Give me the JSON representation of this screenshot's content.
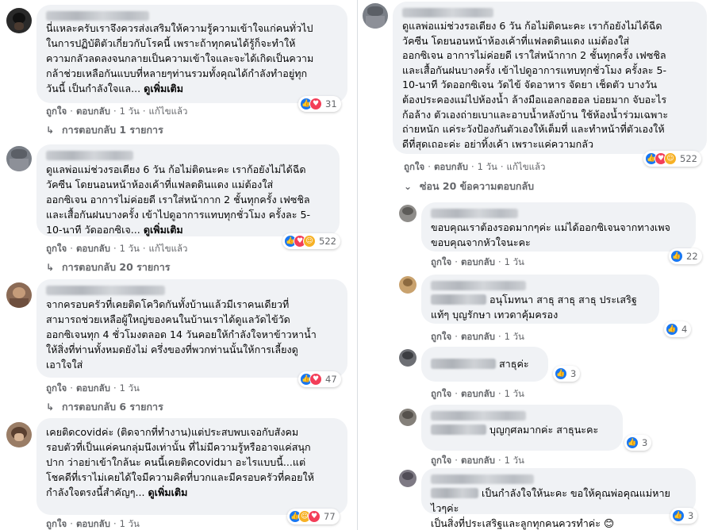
{
  "common": {
    "like": "ถูกใจ",
    "reply": "ตอบกลับ",
    "edited": "แก้ไขแล้ว",
    "see_more": "ดูเพิ่มเติม",
    "age_1_day": "1 วัน"
  },
  "left_comments": [
    {
      "text": "นี่แหละครับเราจึงควรส่งเสริมให้ความรู้ความเข้าใจแก่คนทั่วไป\nในการปฏิบัติตัวเกี่ยวกับโรคนี้ เพราะถ้าทุกคนได้รู้ก็จะทำให้\nความกลัวลดลงจนกลายเป็นความเข้าใจและจะได้เกิดเป็นความ\nกล้าช่วยเหลือกันแบบที่หลายๆท่านรวมทั้งคุณได้กำลังทำอยู่ทุก\nวันนี้ เป็นกำลังใจแล...",
      "reactions": [
        "like",
        "love"
      ],
      "count": "31",
      "replies": "การตอบกลับ 1 รายการ"
    },
    {
      "text": "ดูแลพ่อแม่ช่วงรอเตียง 6 วัน ก้อไม่ติดนะคะ เราก้อยังไม่ได้ฉีด\nวัคซีน โดยนอนหน้าห้องเค้าที่แฟลตดินแดง แม่ต้องใส่\nออกซิเจน อาการไม่ค่อยดี เราใส่หน้ากาก 2 ชั้นทุกครั้ง เฟซชิล\nและเสื้อกันฝนบางครั้ง เข้าไปดูอาการแทบทุกชั่วโมง ครั้งละ 5-\n10-นาที วัดออกซิเจ...",
      "reactions": [
        "like",
        "love",
        "care"
      ],
      "count": "522",
      "replies": "การตอบกลับ 20 รายการ"
    },
    {
      "text": "จากครอบครัวที่เคยติดโควิดกันทั้งบ้านแล้วมีเราคนเดียวที่\nสามารถช่วยเหลือผู้ใหญ่ของคนในบ้านเราได้ดูแลวัดไข้วัด\nออกซิเจนทุก 4 ชั่วโมงตลอด 14 วันคอยให้กำลังใจหาข้าวหาน้ำ\nให้สิ่งที่ท่านทั้งหมดยังไม่ ครึ่งของที่พวกท่านนั้นให้การเลี้ยงดู\nเอาใจใส่",
      "reactions": [
        "like",
        "love"
      ],
      "count": "47",
      "replies": "การตอบกลับ 6 รายการ"
    },
    {
      "text": "เคยติดcovidค่ะ (ติดจากที่ทำงาน)แต่ประสบพบเจอกับสังคม\nรอบตัวที่เป็นแค่คนกลุ่มนึงเท่านั้น ที่ไม่มีความรู้หรืออาจแค่สนุก\nปาก ว่าอย่าเข้าใกล้นะ คนนี้เคยติดcovidมา อะไรแบบนี้...แต่\nโชคดีที่เราไม่เคยได้ใจมีความคิดที่บวกและมีครอบครัวที่คอยให้\nกำลังใจตรงนี้สำคัญๆ...",
      "reactions": [
        "like",
        "care",
        "love"
      ],
      "count": "77"
    }
  ],
  "right_main": {
    "text": "ดูแลพ่อแม่ช่วงรอเตียง 6 วัน ก้อไม่ติดนะคะ เราก้อยังไม่ได้ฉีด\nวัคซีน โดยนอนหน้าห้องเค้าที่แฟลตดินแดง แม่ต้องใส่\nออกซิเจน อาการไม่ค่อยดี เราใส่หน้ากาก 2 ชั้นทุกครั้ง เฟซชิล\nและเสื้อกันฝนบางครั้ง เข้าไปดูอาการแทบทุกชั่วโมง ครั้งละ 5-\n10-นาที วัดออกซิเจน วัดไข้ จัดอาหาร จัดยา เช็ดตัว บางวัน\nต้องประคองแม่ไปห้องน้ำ ล้างมือแอลกอฮอล บ่อยมาก จับอะไร\nก้อล้าง ตัวเองถ่ายเบาและอาบน้ำหลังบ้าน ใช้ห้องน้ำร่วมเฉพาะ\nถ่ายหนัก แค่ระวังป้องกันตัวเองให้เต็มที่ และทำหน้าที่ตัวเองให้\nดีที่สุดเถอะค่ะ อย่าทิ้งเค้า เพราะแค่ความกลัว",
    "reactions": [
      "like",
      "love",
      "care"
    ],
    "count": "522",
    "hide_replies": "ซ่อน 20 ข้อความตอบกลับ"
  },
  "right_replies": [
    {
      "text": "ขอบคุณเราต้องรอดมากๆค่ะ แม่ได้ออกซิเจนจากทางเพจ\nขอบคุณจากหัวใจนะคะ",
      "reactions": [
        "like"
      ],
      "count": "22"
    },
    {
      "text": "อนุโมทนา สาธุ สาธุ สาธุ ประเสริฐ\nแท้ๆ บุญรักษา เทวดาคุ้มครอง",
      "reactions": [
        "like"
      ],
      "count": "4"
    },
    {
      "text": "สาธุค่ะ",
      "reactions": [
        "like"
      ],
      "count": "3"
    },
    {
      "text": "บุญกุศลมากค่ะ สาธุนะคะ",
      "reactions": [
        "like"
      ],
      "count": "3"
    },
    {
      "text": "เป็นกำลังใจให้นะคะ ขอให้คุณพ่อคุณแม่หายไวๆค่ะ\nเป็นสิ่งที่ประเสริฐและลูกทุกคนควรทำค่ะ",
      "emoji": "😊",
      "reactions": [
        "like"
      ],
      "count": "3"
    }
  ],
  "colors": {
    "bubble": "#f0f2f5",
    "meta_text": "#65676b",
    "like_blue": "#1877f2",
    "love_red": "#f33e58",
    "care_yellow": "#f7b125"
  },
  "icons": {
    "like": "like-icon",
    "love": "love-icon",
    "care": "care-icon",
    "replies_arrow": "reply-arrow-icon",
    "hide_arrow": "collapse-arrow-icon"
  }
}
